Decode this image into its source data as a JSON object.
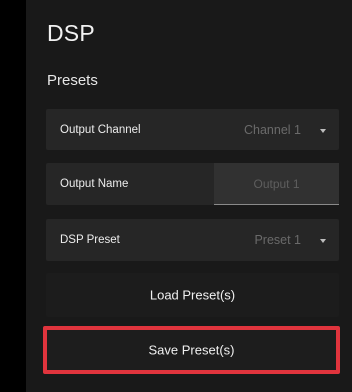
{
  "header": {
    "title": "DSP",
    "section": "Presets"
  },
  "output_channel": {
    "label": "Output Channel",
    "value": "Channel 1"
  },
  "output_name": {
    "label": "Output Name",
    "placeholder": "Output 1"
  },
  "dsp_preset": {
    "label": "DSP Preset",
    "value": "Preset 1"
  },
  "buttons": {
    "load": "Load Preset(s)",
    "save": "Save Preset(s)"
  },
  "colors": {
    "highlight": "#e0343d",
    "panel": "#191919",
    "row": "#262626"
  }
}
